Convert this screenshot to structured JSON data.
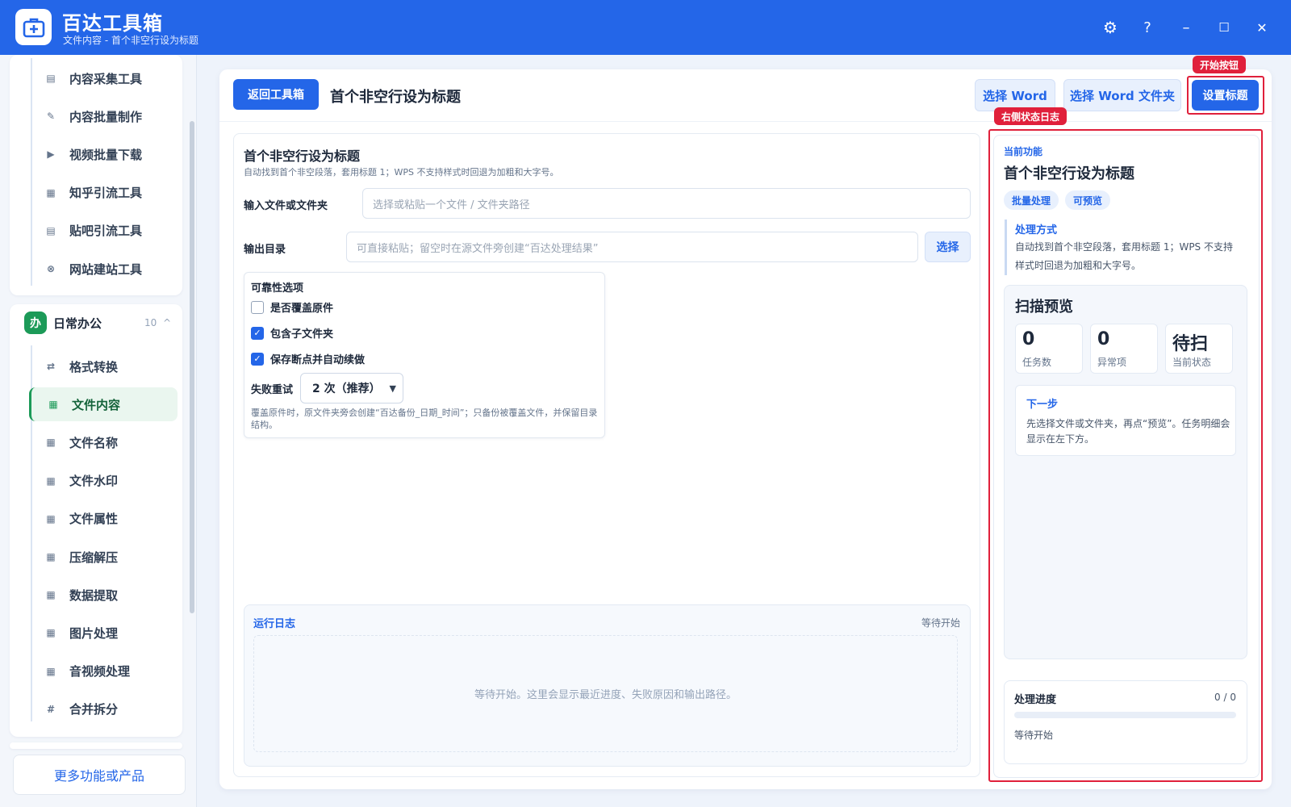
{
  "app": {
    "title": "百达工具箱",
    "subtitle": "文件内容 - 首个非空行设为标题",
    "controls": {
      "settings": "⚙",
      "help": "?",
      "minimize": "–",
      "maximize": "☐",
      "close": "✕"
    }
  },
  "sidebar": {
    "top_items": [
      {
        "label": "内容采集工具",
        "icon": "collect-icon",
        "glyph": "▤"
      },
      {
        "label": "内容批量制作",
        "icon": "pen-icon",
        "glyph": "✎"
      },
      {
        "label": "视频批量下载",
        "icon": "video-icon",
        "glyph": "▶"
      },
      {
        "label": "知乎引流工具",
        "icon": "zhihu-icon",
        "glyph": "▦"
      },
      {
        "label": "贴吧引流工具",
        "icon": "tieba-icon",
        "glyph": "▤"
      },
      {
        "label": "网站建站工具",
        "icon": "web-icon",
        "glyph": "⊗"
      }
    ],
    "group": {
      "badge": "办",
      "name": "日常办公",
      "count": "10",
      "chevron": "^"
    },
    "group_items": [
      {
        "label": "格式转换",
        "icon": "swap-icon",
        "glyph": "⇄"
      },
      {
        "label": "文件内容",
        "icon": "grid-icon",
        "glyph": "▦",
        "active": true
      },
      {
        "label": "文件名称",
        "icon": "grid-icon",
        "glyph": "▦"
      },
      {
        "label": "文件水印",
        "icon": "grid-icon",
        "glyph": "▦"
      },
      {
        "label": "文件属性",
        "icon": "grid-icon",
        "glyph": "▦"
      },
      {
        "label": "压缩解压",
        "icon": "grid-icon",
        "glyph": "▦"
      },
      {
        "label": "数据提取",
        "icon": "grid-icon",
        "glyph": "▦"
      },
      {
        "label": "图片处理",
        "icon": "grid-icon",
        "glyph": "▦"
      },
      {
        "label": "音视频处理",
        "icon": "grid-icon",
        "glyph": "▦"
      },
      {
        "label": "合并拆分",
        "icon": "hash-icon",
        "glyph": "#"
      }
    ],
    "more_label": "更多功能或产品"
  },
  "header": {
    "back_label": "返回工具箱",
    "title": "首个非空行设为标题",
    "select_word": "选择 Word",
    "select_word_folder": "选择 Word 文件夹",
    "start_label": "设置标题"
  },
  "form": {
    "title": "首个非空行设为标题",
    "desc": "自动找到首个非空段落，套用标题 1；WPS 不支持样式时回退为加粗和大字号。",
    "input_label": "输入文件或文件夹",
    "input_placeholder": "选择或粘贴一个文件 / 文件夹路径",
    "output_label": "输出目录",
    "output_placeholder": "可直接粘贴；留空时在源文件旁创建“百达处理结果”",
    "output_button": "选择",
    "options_title": "可靠性选项",
    "options": [
      {
        "label": "是否覆盖原件",
        "checked": false
      },
      {
        "label": "包含子文件夹",
        "checked": true
      },
      {
        "label": "保存断点并自动续做",
        "checked": true
      }
    ],
    "retry_label": "失败重试",
    "retry_value": "2 次（推荐）",
    "note": "覆盖原件时，原文件夹旁会创建“百达备份_日期_时间”；只备份被覆盖文件，并保留目录结构。"
  },
  "log": {
    "title": "运行日志",
    "status": "等待开始",
    "empty": "等待开始。这里会显示最近进度、失败原因和输出路径。"
  },
  "right": {
    "current_label": "当前功能",
    "title": "首个非空行设为标题",
    "tags": [
      "批量处理",
      "可预览"
    ],
    "method_title": "处理方式",
    "method_desc": "自动找到首个非空段落，套用标题 1；WPS 不支持样式时回退为加粗和大字号。",
    "scan_title": "扫描预览",
    "stats": [
      {
        "value": "0",
        "caption": "任务数"
      },
      {
        "value": "0",
        "caption": "异常项"
      },
      {
        "value": "待扫",
        "caption": "当前状态"
      }
    ],
    "next_title": "下一步",
    "next_desc": "先选择文件或文件夹，再点“预览”。任务明细会显示在左下方。",
    "progress_title": "处理进度",
    "progress_count": "0 / 0",
    "progress_fraction": 0,
    "progress_status": "等待开始"
  },
  "annotations": {
    "start_button_tag": "开始按钮",
    "right_log_tag": "右侧状态日志"
  },
  "colors": {
    "accent": "#2466e8",
    "active_green": "#1c9a58",
    "annotation_red": "#e0203b"
  }
}
